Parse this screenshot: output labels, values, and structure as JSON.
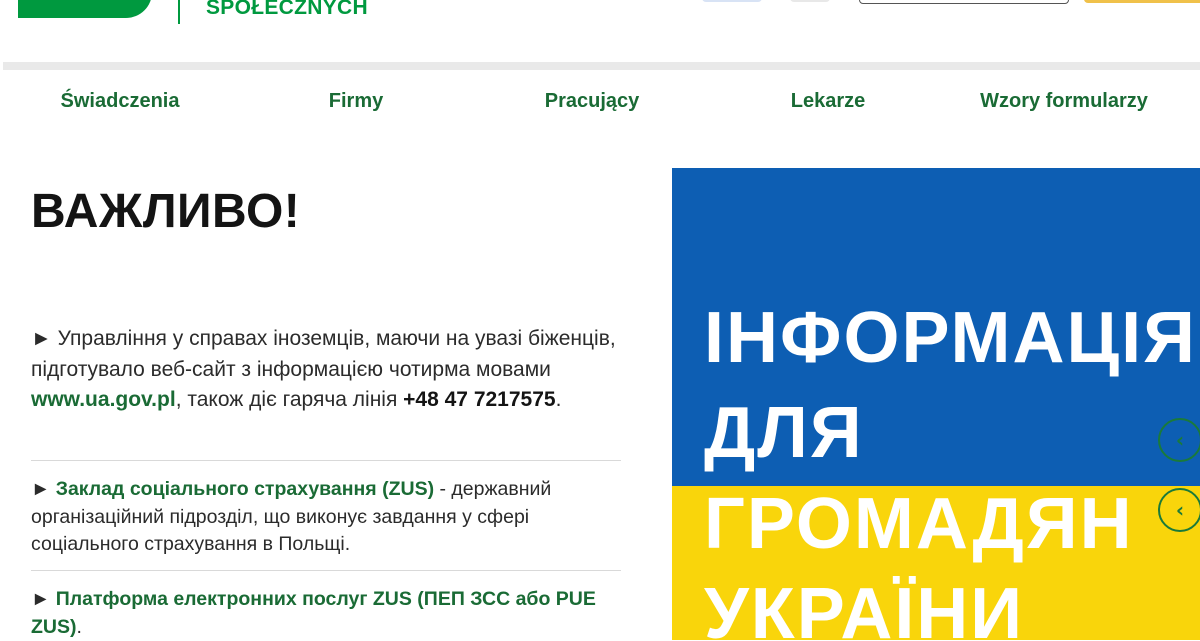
{
  "header": {
    "logo_text": "SPOŁECZNYCH"
  },
  "nav": {
    "items": [
      {
        "label": "Świadczenia"
      },
      {
        "label": "Firmy"
      },
      {
        "label": "Pracujący"
      },
      {
        "label": "Lekarze"
      },
      {
        "label": "Wzory formularzy"
      }
    ]
  },
  "main": {
    "heading": "ВАЖЛИВО!",
    "para1": {
      "bullet": "►",
      "text_before": " Управління у справах іноземців, маючи на увазі біженців, підготувало веб-сайт з інформацією чотирма мовами ",
      "link": "www.ua.gov.pl",
      "text_middle": ", також діє гаряча лінія ",
      "phone": "+48 47 7217575",
      "text_after": "."
    },
    "para2": {
      "bullet": "►",
      "link": "Заклад соціального страхування (ZUS)",
      "text_after": " - державний організаційний підрозділ, що виконує завдання у сфері соціального страхування в Польщі."
    },
    "para3": {
      "bullet": "►",
      "link": "Платформа електронних послуг ZUS (ПЕП ЗСС або PUE ZUS)",
      "text_after": "."
    }
  },
  "banner": {
    "line1": "ІНФОРМАЦІЯ",
    "line2": "ДЛЯ",
    "line3": "ГРОМАДЯН",
    "line4": "УКРАЇНИ",
    "colors": {
      "top": "#0d5eb3",
      "bottom": "#f9d50b"
    }
  },
  "carousel": {
    "prev_glyph": "‹",
    "next_glyph": "‹"
  }
}
